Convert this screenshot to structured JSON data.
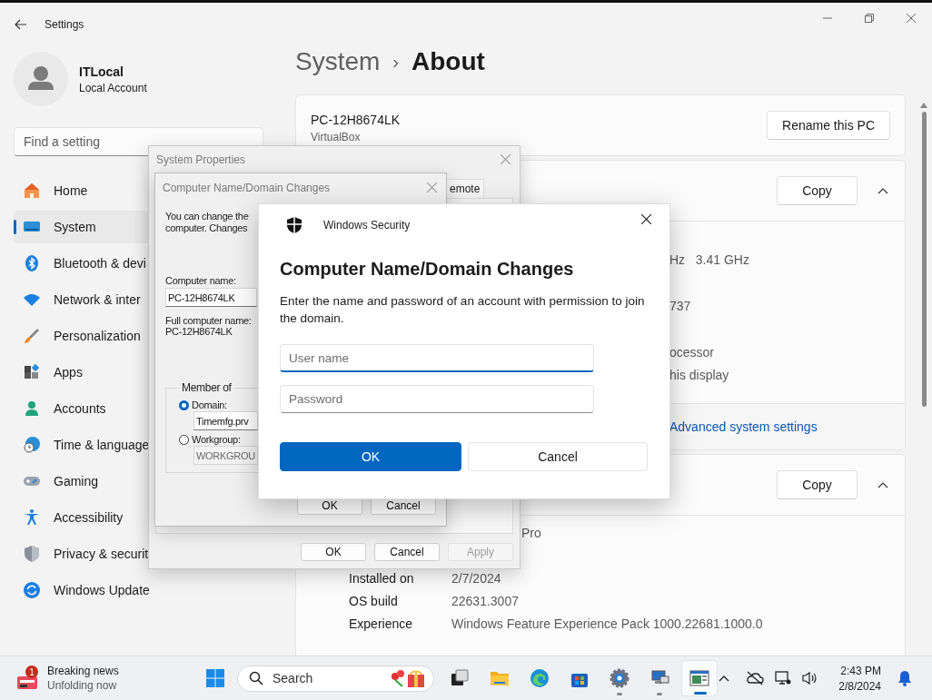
{
  "window": {
    "title": "Settings"
  },
  "account": {
    "name": "ITLocal",
    "type": "Local Account"
  },
  "search": {
    "placeholder": "Find a setting"
  },
  "nav": [
    {
      "label": "Home",
      "selected": false
    },
    {
      "label": "System",
      "selected": true
    },
    {
      "label": "Bluetooth & devi",
      "selected": false
    },
    {
      "label": "Network & inter",
      "selected": false
    },
    {
      "label": "Personalization",
      "selected": false
    },
    {
      "label": "Apps",
      "selected": false
    },
    {
      "label": "Accounts",
      "selected": false
    },
    {
      "label": "Time & language",
      "selected": false
    },
    {
      "label": "Gaming",
      "selected": false
    },
    {
      "label": "Accessibility",
      "selected": false
    },
    {
      "label": "Privacy & securit",
      "selected": false
    },
    {
      "label": "Windows Update",
      "selected": false
    }
  ],
  "breadcrumb": {
    "parent": "System",
    "separator": "›",
    "current": "About"
  },
  "device": {
    "name": "PC-12H8674LK",
    "model": "VirtualBox",
    "rename_button": "Rename this PC"
  },
  "specs": {
    "copy_button": "Copy",
    "expanded": true,
    "fragments": [
      "Hz   3.41 GHz",
      "737",
      "ocessor",
      "his display"
    ],
    "link": "Advanced system settings"
  },
  "windows_specs": {
    "copy_button": "Copy",
    "expanded": true,
    "rows": [
      {
        "kind": "partial",
        "value": "Pro"
      },
      {
        "kind": "full",
        "label": "Installed on",
        "value": "2/7/2024"
      },
      {
        "kind": "full",
        "label": "OS build",
        "value": "22631.3007"
      },
      {
        "kind": "full",
        "label": "Experience",
        "value": "Windows Feature Experience Pack 1000.22681.1000.0"
      }
    ]
  },
  "system_properties": {
    "title": "System Properties",
    "tab": "emote",
    "buttons": [
      {
        "label": "OK",
        "disabled": false
      },
      {
        "label": "Cancel",
        "disabled": false
      },
      {
        "label": "Apply",
        "disabled": true
      }
    ]
  },
  "name_changes": {
    "title": "Computer Name/Domain Changes",
    "intro": [
      "You can change the",
      "computer. Changes"
    ],
    "computer_name_label": "Computer name:",
    "computer_name": "PC-12H8674LK",
    "full_name_label": "Full computer name:",
    "full_name": "PC-12H8674LK",
    "member_of": "Member of",
    "options": [
      {
        "label": "Domain:",
        "selected": true,
        "value": "Timemfg.prv"
      },
      {
        "label": "Workgroup:",
        "selected": false,
        "value": "WORKGROU"
      }
    ],
    "buttons": [
      "OK",
      "Cancel"
    ]
  },
  "security": {
    "app": "Windows Security",
    "heading": "Computer Name/Domain Changes",
    "message": "Enter the name and password of an account with permission to join the domain.",
    "fields": [
      {
        "placeholder": "User name",
        "focused": true
      },
      {
        "placeholder": "Password",
        "focused": false
      }
    ],
    "buttons": [
      {
        "label": "OK",
        "primary": true
      },
      {
        "label": "Cancel",
        "primary": false
      }
    ]
  },
  "taskbar": {
    "news": {
      "badge": "1",
      "title": "Breaking news",
      "subtitle": "Unfolding now"
    },
    "search": {
      "placeholder": "Search"
    },
    "apps": [
      {
        "running": false,
        "active": false
      },
      {
        "running": false,
        "active": false
      },
      {
        "running": false,
        "active": false
      },
      {
        "running": false,
        "active": false
      },
      {
        "running": true,
        "active": false
      },
      {
        "running": true,
        "active": false
      },
      {
        "running": true,
        "active": true
      }
    ],
    "time": "2:43 PM",
    "date": "2/8/2024"
  }
}
